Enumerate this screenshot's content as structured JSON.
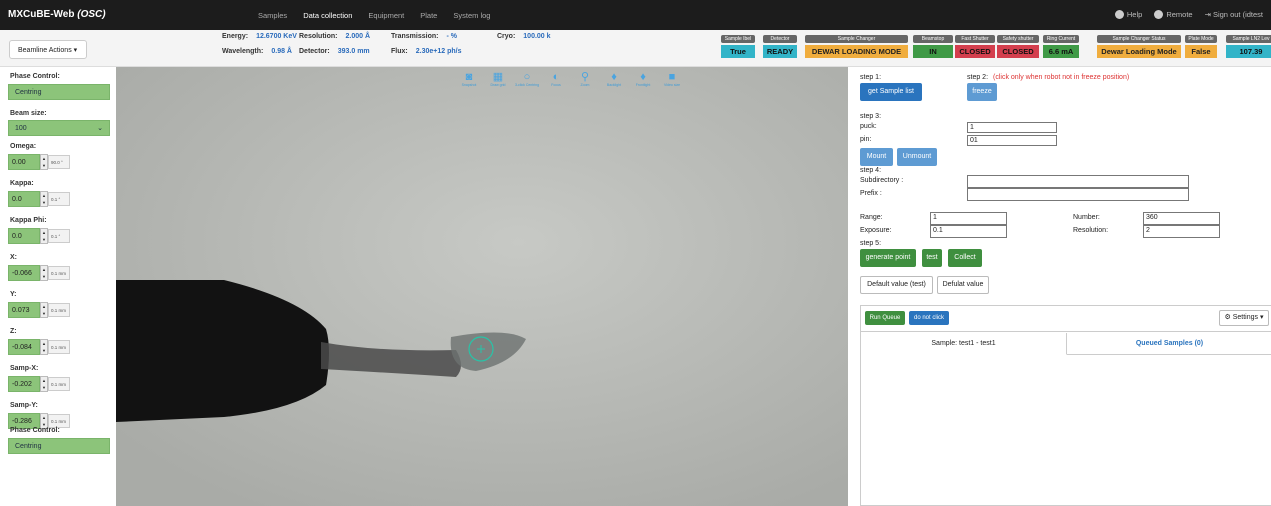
{
  "navbar": {
    "brand": "MXCuBE-Web",
    "brand_site": "(OSC)",
    "items": [
      "Samples",
      "Data collection",
      "Equipment",
      "Plate",
      "System log"
    ],
    "active": "Data collection",
    "help": "Help",
    "remote": "Remote",
    "signout": "Sign out (idtest"
  },
  "topbar": {
    "beamline_actions": "Beamline Actions ▾",
    "motors": [
      {
        "label": "Energy:",
        "value": "12.6700 KeV"
      },
      {
        "label": "Wavelength:",
        "value": "0.98 Å"
      },
      {
        "label": "Resolution:",
        "value": "2.000 Å"
      },
      {
        "label": "Detector:",
        "value": "393.0 mm"
      },
      {
        "label": "Transmission:",
        "value": "- %"
      },
      {
        "label": "Flux:",
        "value": "2.30e+12 ph/s"
      },
      {
        "label": "Cryo:",
        "value": "100.00 k"
      }
    ],
    "status": [
      {
        "header": "Sample Ibel",
        "value": "True",
        "color": "#32b4c8"
      },
      {
        "header": "Detector",
        "value": "READY",
        "color": "#32b4c8"
      },
      {
        "header": "Sample Changer",
        "value": "DEWAR LOADING MODE",
        "color": "#f0ad3e"
      },
      {
        "header": "Beamstop",
        "value": "IN",
        "color": "#3f9a46"
      },
      {
        "header": "Fast Shutter",
        "value": "CLOSED",
        "color": "#d43f4e"
      },
      {
        "header": "Safety shutter",
        "value": "CLOSED",
        "color": "#d43f4e"
      },
      {
        "header": "Ring Current",
        "value": "6.6 mA",
        "color": "#3f9a46"
      },
      {
        "header": "Sample Changer Status",
        "value": "Dewar Loading Mode",
        "color": "#f0ad3e"
      },
      {
        "header": "Plate Mode",
        "value": "False",
        "color": "#f0ad3e"
      },
      {
        "header": "Sample LN2 Lev",
        "value": "107.39",
        "color": "#32b4c8"
      }
    ]
  },
  "left": {
    "phase_label": "Phase Control:",
    "phase_value": "Centring",
    "beam_label": "Beam size:",
    "beam_value": "100",
    "motors": [
      {
        "label": "Omega:",
        "value": "0.00",
        "step": "90.0 °"
      },
      {
        "label": "Kappa:",
        "value": "0.0",
        "step": "0.1 °"
      },
      {
        "label": "Kappa Phi:",
        "value": "0.0",
        "step": "0.1 °"
      },
      {
        "label": "X:",
        "value": "-0.066",
        "step": "0.1 mm"
      },
      {
        "label": "Y:",
        "value": "0.073",
        "step": "0.1 mm"
      },
      {
        "label": "Z:",
        "value": "-0.084",
        "step": "0.1 mm"
      },
      {
        "label": "Samp-X:",
        "value": "-0.202",
        "step": "0.1 mm"
      },
      {
        "label": "Samp-Y:",
        "value": "-0.286",
        "step": "0.1 mm"
      }
    ],
    "phase2_label": "Phase Control:",
    "phase2_value": "Centring"
  },
  "tools": [
    {
      "icon": "camera-icon",
      "glyph": "◙",
      "label": "Snapshot"
    },
    {
      "icon": "grid-icon",
      "glyph": "▦",
      "label": "Draw grid"
    },
    {
      "icon": "circle-icon",
      "glyph": "○",
      "label": "3-click Centring"
    },
    {
      "icon": "focus-icon",
      "glyph": "◐",
      "label": "Focus"
    },
    {
      "icon": "zoom-icon",
      "glyph": "⚲",
      "label": "Zoom"
    },
    {
      "icon": "backlight-icon",
      "glyph": "♦",
      "label": "Backlight"
    },
    {
      "icon": "frontlight-icon",
      "glyph": "♦",
      "label": "Frontlight"
    },
    {
      "icon": "video-icon",
      "glyph": "■",
      "label": "Video size"
    }
  ],
  "right": {
    "step1": "step 1:",
    "get_sample_list": "get Sample list",
    "step2": "step 2:",
    "step2_note": "(click only when robot not in freeze position)",
    "freeze": "freeze",
    "step3": "step 3:",
    "puck_label": "puck:",
    "puck_value": "1",
    "pin_label": "pin:",
    "pin_value": "01",
    "mount": "Mount",
    "unmount": "Unmount",
    "step4": "step 4:",
    "subdir_label": "Subdirectory :",
    "prefix_label": "Prefix :",
    "range_label": "Range:",
    "range_value": "1",
    "number_label": "Number:",
    "number_value": "360",
    "exposure_label": "Exposure:",
    "exposure_value": "0.1",
    "resolution_label": "Resolution:",
    "resolution_value": "2",
    "step5": "step 5:",
    "generate_point": "generate point",
    "test": "test",
    "collect": "Collect",
    "default_test": "Default value (test)",
    "default_value": "Defulat value",
    "run_queue": "Run Queue",
    "do_not_click": "do not click",
    "settings": "⚙ Settings ▾",
    "tab_sample": "Sample: test1 - test1",
    "tab_queued": "Queued Samples (0)"
  }
}
